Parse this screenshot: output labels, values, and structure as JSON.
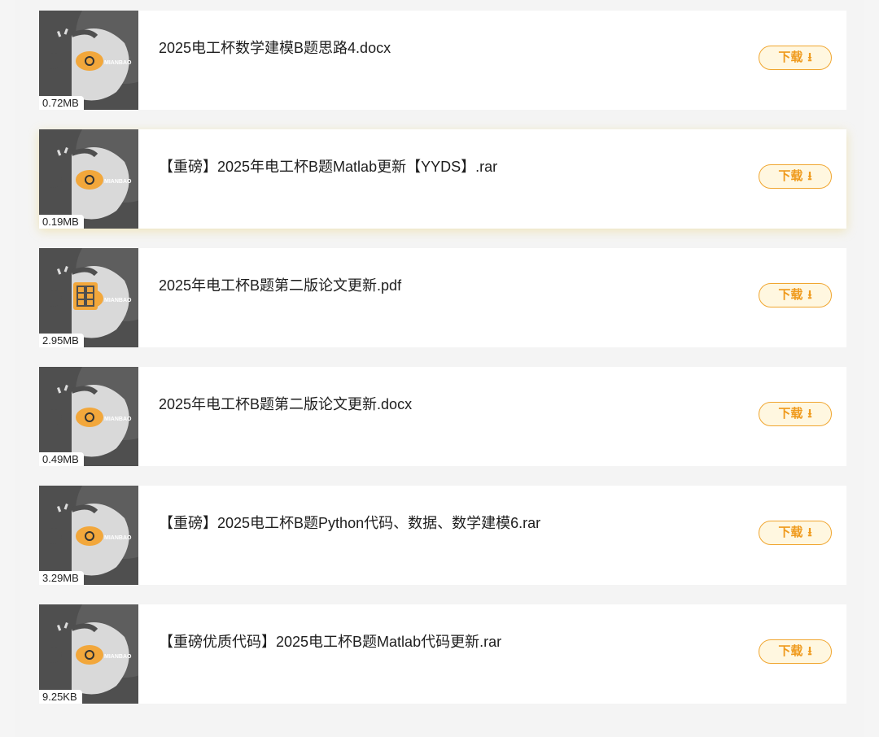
{
  "files": [
    {
      "name": "2025电工杯数学建模B题思路4.docx",
      "size": "0.72MB",
      "download_label": "下载",
      "icon": "eye-icon"
    },
    {
      "name": "【重磅】2025年电工杯B题Matlab更新【YYDS】.rar",
      "size": "0.19MB",
      "download_label": "下载",
      "icon": "eye-icon"
    },
    {
      "name": "2025年电工杯B题第二版论文更新.pdf",
      "size": "2.95MB",
      "download_label": "下载",
      "icon": "book-icon"
    },
    {
      "name": "2025年电工杯B题第二版论文更新.docx",
      "size": "0.49MB",
      "download_label": "下载",
      "icon": "eye-icon"
    },
    {
      "name": "【重磅】2025电工杯B题Python代码、数据、数学建模6.rar",
      "size": "3.29MB",
      "download_label": "下载",
      "icon": "eye-icon"
    },
    {
      "name": "【重磅优质代码】2025电工杯B题Matlab代码更新.rar",
      "size": "9.25KB",
      "download_label": "下载",
      "icon": "eye-icon"
    }
  ],
  "thumb_brand": "MIANBAO",
  "colors": {
    "accent": "#f0a630",
    "accent_text": "#ef9a1c",
    "accent_bg": "#fff7e0",
    "thumb_bg": "#4f4f4f"
  }
}
